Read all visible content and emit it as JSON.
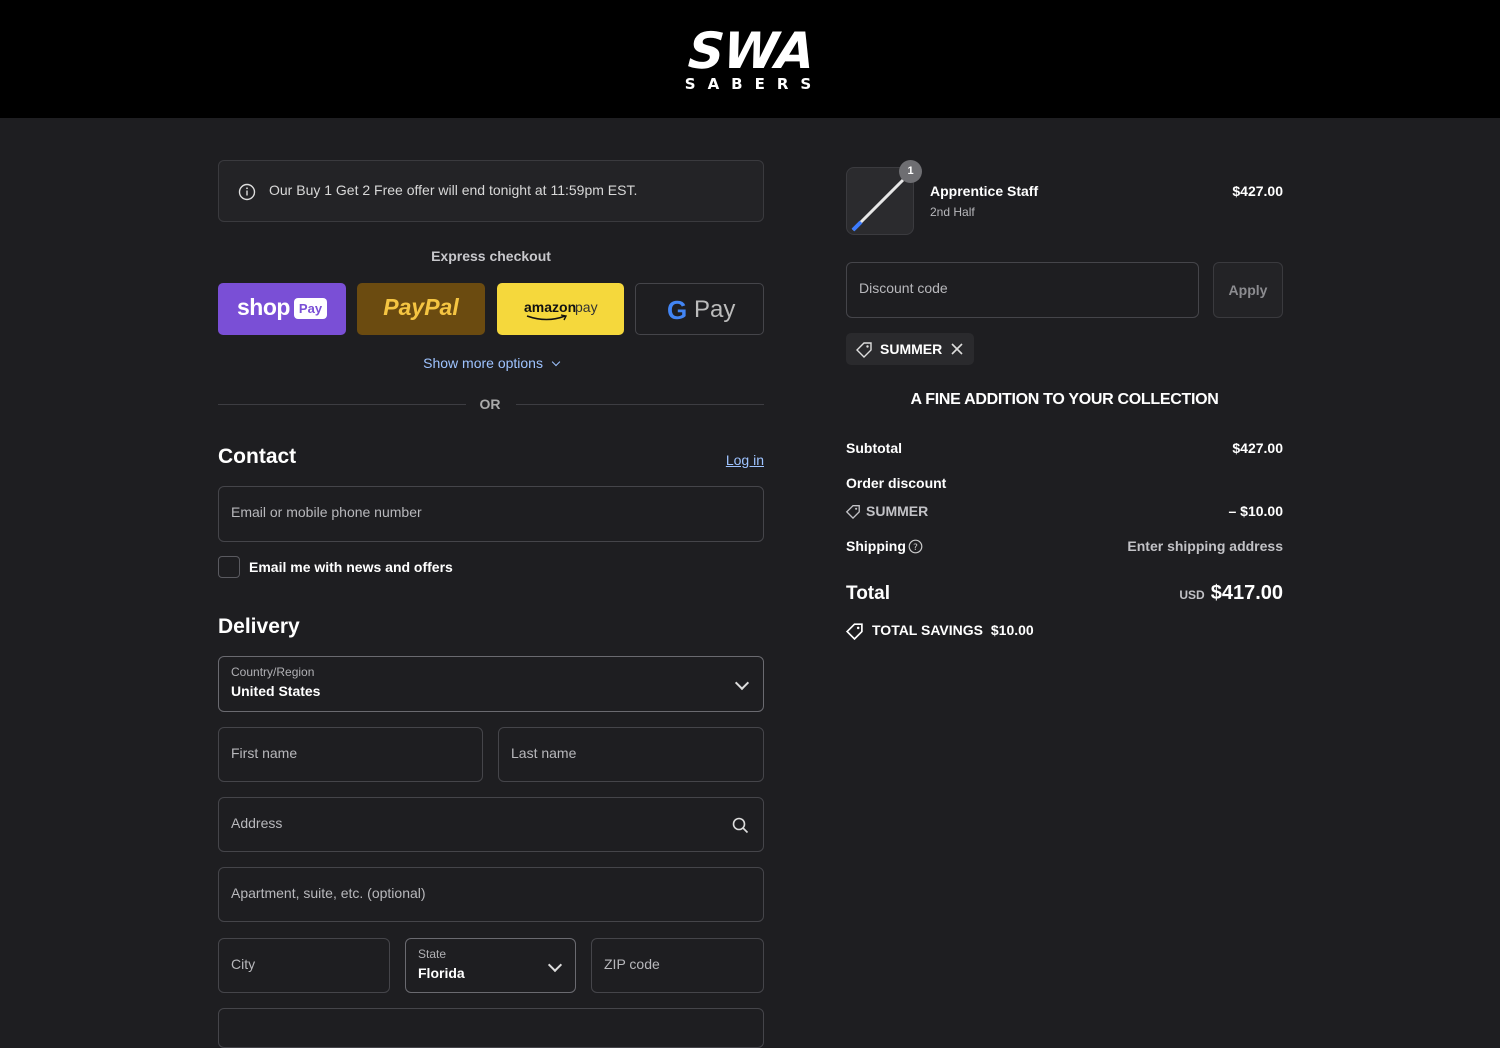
{
  "brand": {
    "name": "SWA",
    "tagline": "SABERS"
  },
  "notice": {
    "text": "Our Buy 1 Get 2 Free offer will end tonight at 11:59pm EST."
  },
  "express": {
    "title": "Express checkout",
    "shop_label": "shop",
    "shop_pay_badge": "Pay",
    "paypal_label": "PayPal",
    "amazon_label": "amazon",
    "amazon_pay": "pay",
    "gpay_label": "Pay",
    "show_more": "Show more options",
    "or": "OR"
  },
  "contact": {
    "title": "Contact",
    "login": "Log in",
    "email_placeholder": "Email or mobile phone number",
    "newsletter_label": "Email me with news and offers"
  },
  "delivery": {
    "title": "Delivery",
    "country_label": "Country/Region",
    "country_value": "United States",
    "first_name": "First name",
    "last_name": "Last name",
    "address": "Address",
    "apartment": "Apartment, suite, etc. (optional)",
    "city": "City",
    "state_label": "State",
    "state_value": "Florida",
    "zip": "ZIP code"
  },
  "order": {
    "item_name": "Apprentice Staff",
    "item_variant": "2nd Half",
    "item_qty": "1",
    "item_price": "$427.00",
    "discount_placeholder": "Discount code",
    "apply_label": "Apply",
    "applied_code": "SUMMER",
    "promo_heading": "A FINE ADDITION TO YOUR COLLECTION",
    "subtotal_label": "Subtotal",
    "subtotal_value": "$427.00",
    "order_discount_label": "Order discount",
    "discount_code": "SUMMER",
    "discount_value": "– $10.00",
    "shipping_label": "Shipping",
    "shipping_value": "Enter shipping address",
    "total_label": "Total",
    "currency": "USD",
    "total_value": "$417.00",
    "savings_label": "TOTAL SAVINGS",
    "savings_value": "$10.00"
  }
}
